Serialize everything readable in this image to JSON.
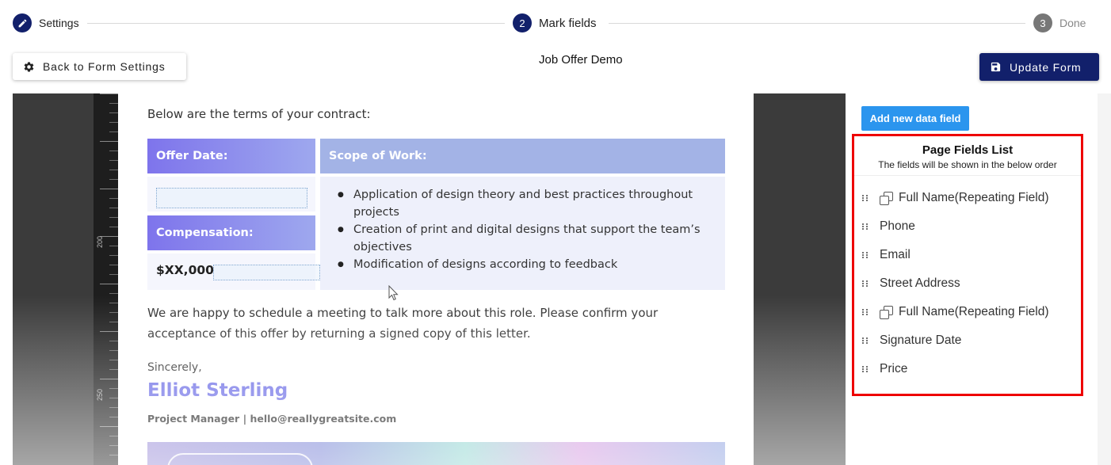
{
  "stepper": {
    "steps": [
      {
        "number": "",
        "label": "Settings",
        "state": "complete",
        "icon": "pencil-icon"
      },
      {
        "number": "2",
        "label": "Mark fields",
        "state": "active"
      },
      {
        "number": "3",
        "label": "Done",
        "state": "pending"
      }
    ]
  },
  "toolbar": {
    "back_label": "Back to Form Settings",
    "back_icon": "gear-icon",
    "form_title": "Job Offer Demo",
    "update_label": "Update Form",
    "update_icon": "save-icon",
    "update_color": "#12206b"
  },
  "document": {
    "ruler_labels": [
      "200",
      "250"
    ],
    "intro": "Below are the terms of your contract:",
    "offer_date_label": "Offer Date:",
    "scope_label": "Scope of Work:",
    "compensation_label": "Compensation:",
    "compensation_value": "$XX,000",
    "scope_items": [
      "Application of design theory and best practices throughout projects",
      "Creation of print and digital designs that support the team’s objectives",
      "Modification of designs according to feedback"
    ],
    "closing_line1": "We are happy to schedule a meeting to talk more about this role. Please confirm your",
    "closing_line2": "acceptance of this offer by returning a signed copy of this letter.",
    "sign_off": "Sincerely,",
    "signer_name": "Elliot Sterling",
    "signer_details": "Project Manager | hello@reallygreatsite.com",
    "header_gradient_start": "#7e74ec",
    "header_gradient_end": "#a3b3e6"
  },
  "fields_panel": {
    "add_button_label": "Add new data field",
    "add_button_color": "#2b95ee",
    "title": "Page Fields List",
    "subtitle": "The fields will be shown in the below order",
    "highlight_color": "#ee0000",
    "items": [
      {
        "label": "Full Name(Repeating Field)",
        "repeating": true
      },
      {
        "label": "Phone",
        "repeating": false
      },
      {
        "label": "Email",
        "repeating": false
      },
      {
        "label": "Street Address",
        "repeating": false
      },
      {
        "label": "Full Name(Repeating Field)",
        "repeating": true
      },
      {
        "label": "Signature Date",
        "repeating": false
      },
      {
        "label": "Price",
        "repeating": false
      }
    ]
  }
}
